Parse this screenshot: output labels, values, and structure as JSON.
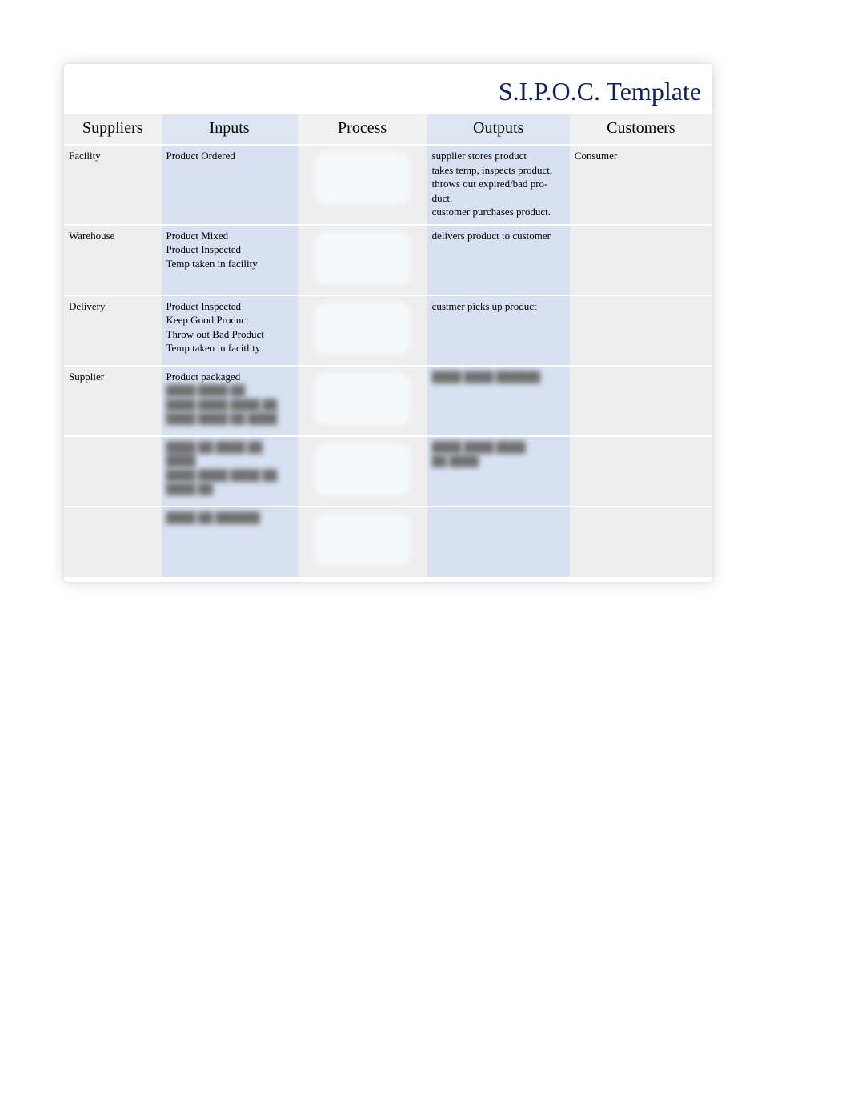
{
  "title": "S.I.P.O.C. Template",
  "headers": {
    "suppliers": "Suppliers",
    "inputs": "Inputs",
    "process": "Process",
    "outputs": "Outputs",
    "customers": "Customers"
  },
  "rows": [
    {
      "supplier": "Facility",
      "inputs": [
        "Product Ordered"
      ],
      "process": "",
      "outputs": [
        "supplier stores product",
        "takes temp, inspects product, throws out expired/bad pro-",
        "duct.",
        "customer purchases product."
      ],
      "customer": "Consumer"
    },
    {
      "supplier": "Warehouse",
      "inputs": [
        "Product Mixed",
        "Product Inspected",
        "Temp taken in facility"
      ],
      "process": "",
      "outputs": [
        "delivers product to customer"
      ],
      "customer": ""
    },
    {
      "supplier": "Delivery",
      "inputs": [
        "Product Inspected",
        "Keep Good Product",
        "Throw out Bad Product",
        "Temp taken in facitlity"
      ],
      "process": "",
      "outputs": [
        "custmer picks up product"
      ],
      "customer": ""
    },
    {
      "supplier": "Supplier",
      "inputs": [
        "Product packaged"
      ],
      "inputs_blurred": [
        "",
        "",
        ""
      ],
      "process": "",
      "outputs_blurred": [
        ""
      ],
      "customer": ""
    },
    {
      "supplier": "",
      "inputs_blurred": [
        "",
        "",
        ""
      ],
      "process": "",
      "outputs_blurred": [
        "",
        ""
      ],
      "customer": ""
    },
    {
      "supplier": "",
      "inputs_blurred": [
        ""
      ],
      "process": "",
      "outputs": [],
      "customer": ""
    }
  ]
}
